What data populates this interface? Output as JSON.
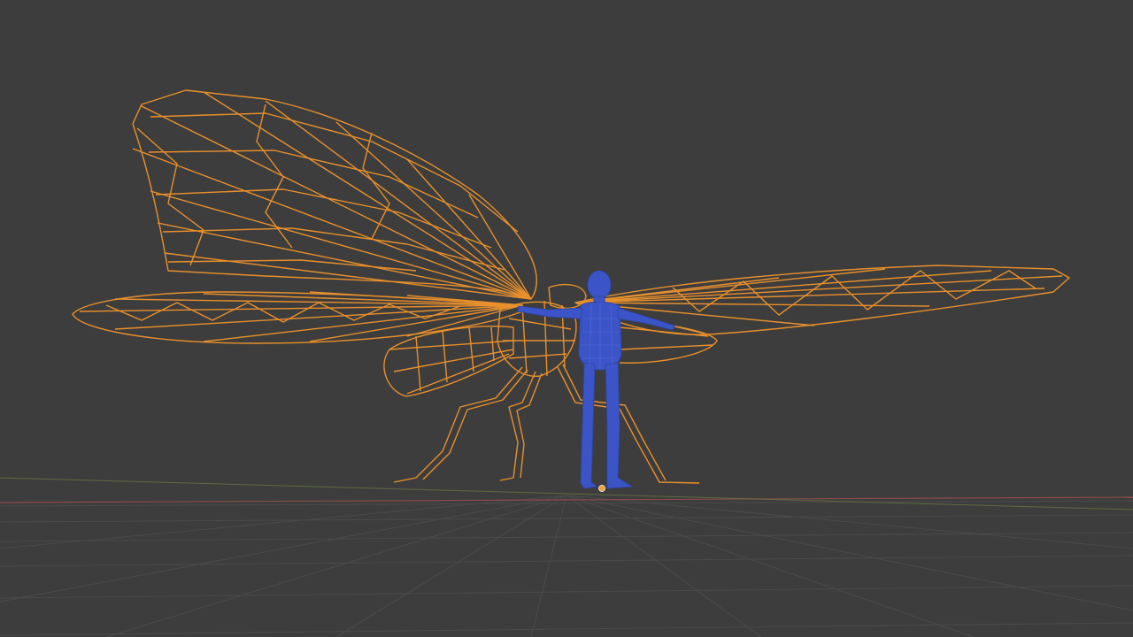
{
  "viewport": {
    "background_color": "#3d3d3d",
    "grid_color": "#4a4a4a",
    "x_axis_color": "#8a4b4b",
    "y_axis_color": "#6b7f3e"
  },
  "objects": [
    {
      "name": "butterfly-wireframe",
      "display": "wireframe",
      "selected": true,
      "color": "#e8902c"
    },
    {
      "name": "human-figure",
      "display": "solid",
      "selected": false,
      "color": "#3b55c8"
    }
  ],
  "origin_marker": {
    "color": "#f0a030"
  }
}
